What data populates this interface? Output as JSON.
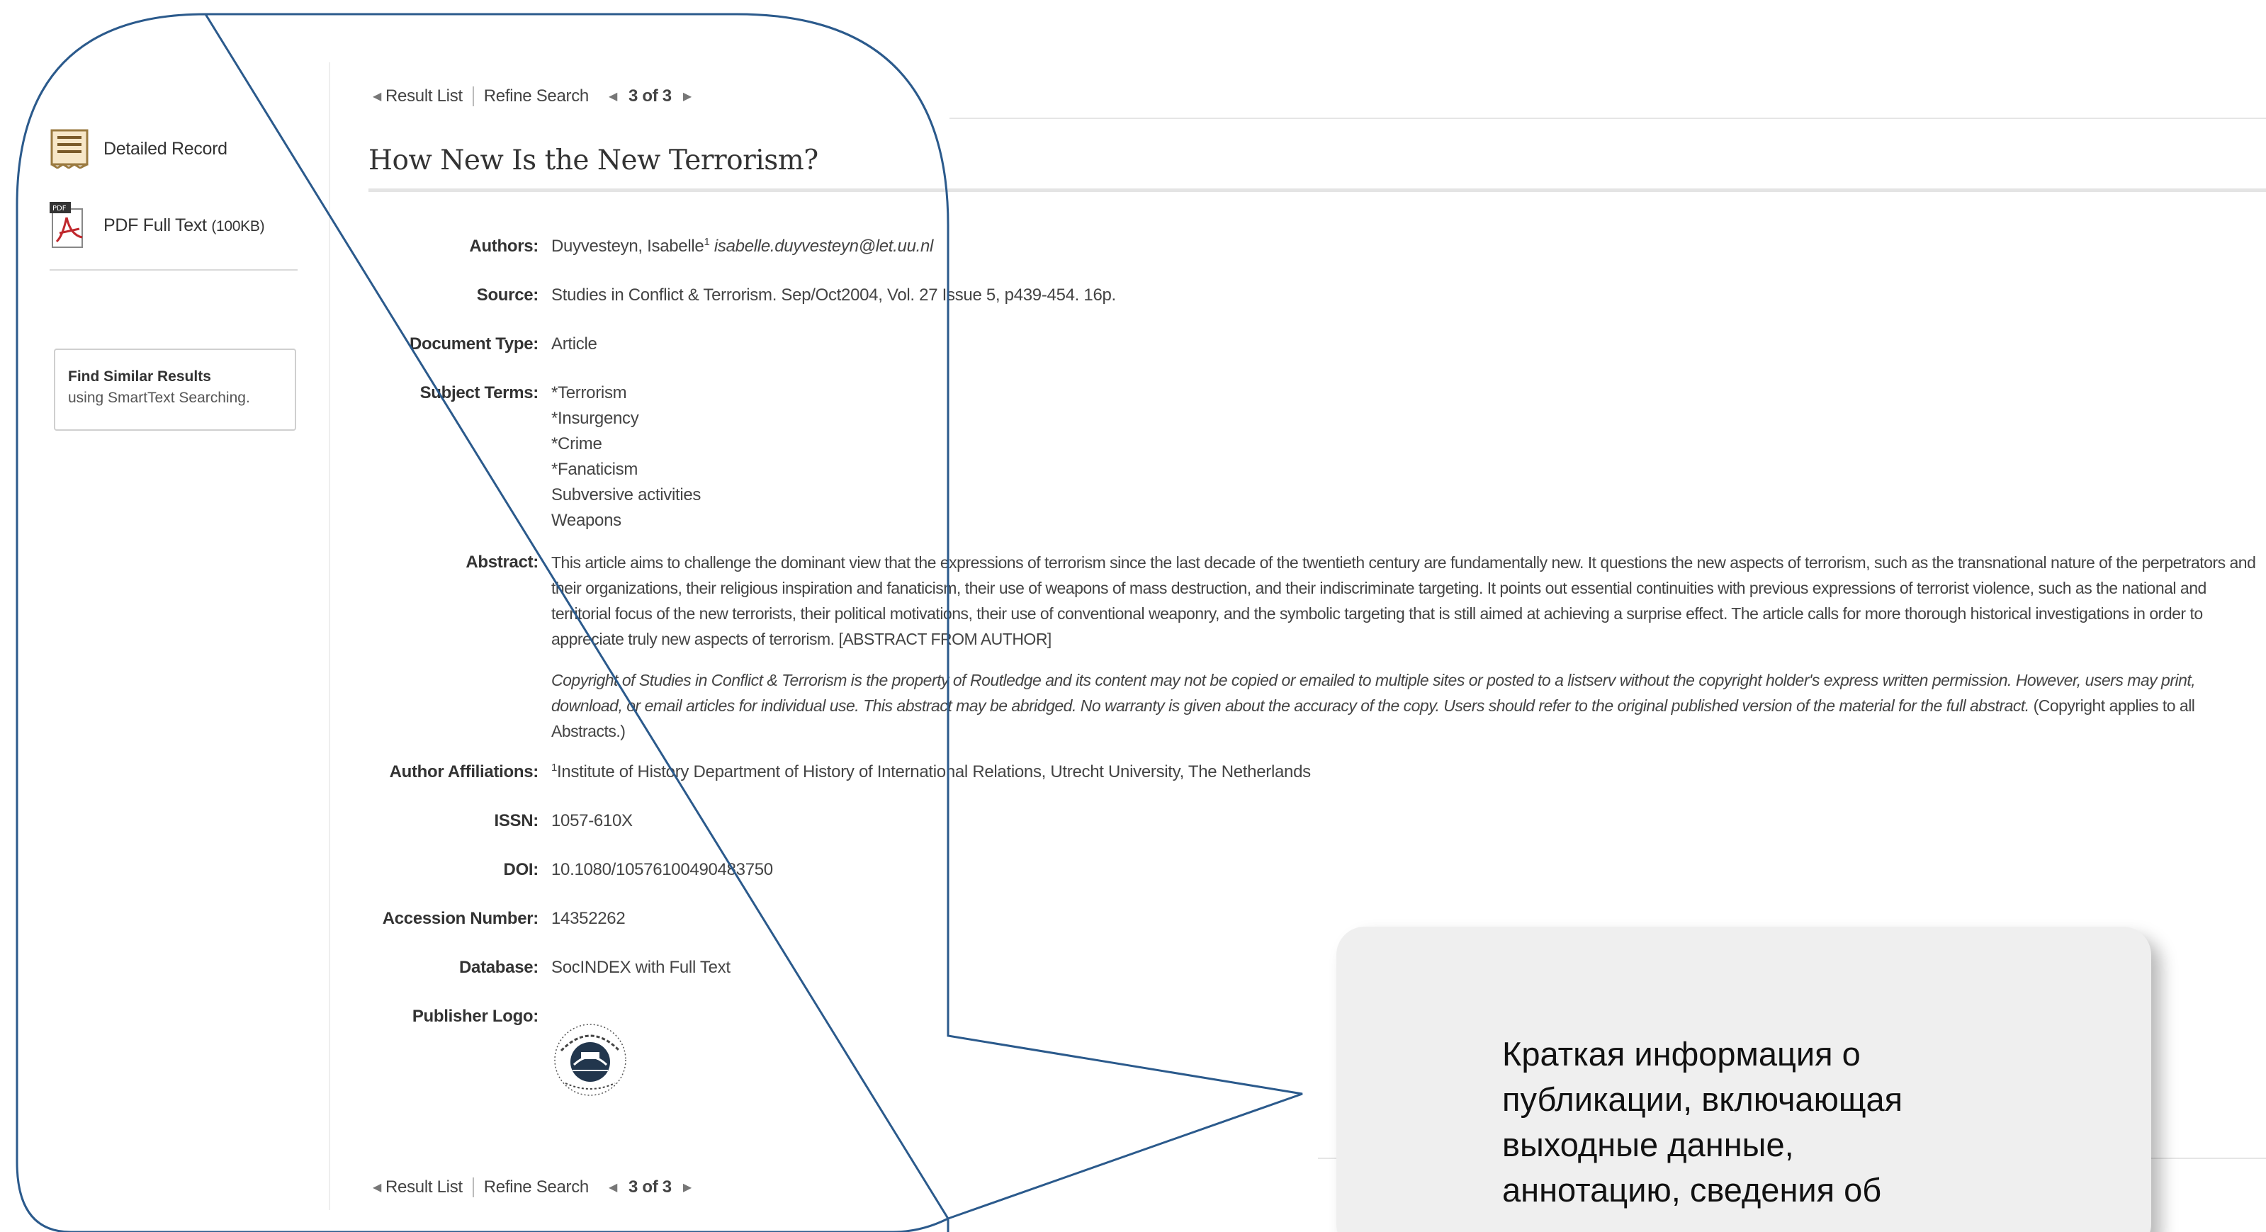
{
  "sidebar": {
    "detailed_record": "Detailed Record",
    "pdf_label": "PDF Full Text",
    "pdf_size": "(100KB)",
    "similar_title": "Find Similar Results",
    "similar_sub": "using SmartText Searching."
  },
  "nav": {
    "result_list": "Result List",
    "refine_search": "Refine Search",
    "count": "3 of 3"
  },
  "record": {
    "title": "How New Is the New Terrorism?",
    "authors_label": "Authors:",
    "author_name": "Duyvesteyn, Isabelle",
    "author_sup": "1",
    "author_email": "isabelle.duyvesteyn@let.uu.nl",
    "source_label": "Source:",
    "source": "Studies in Conflict & Terrorism. Sep/Oct2004, Vol. 27 Issue 5, p439-454. 16p.",
    "doctype_label": "Document Type:",
    "doctype": "Article",
    "subjects_label": "Subject Terms:",
    "subjects": [
      "*Terrorism",
      "*Insurgency",
      "*Crime",
      "*Fanaticism",
      "Subversive activities",
      "Weapons"
    ],
    "abstract_label": "Abstract:",
    "abstract": "This article aims to challenge the dominant view that the expressions of terrorism since the last decade of the twentieth century are fundamentally new. It questions the new aspects of terrorism, such as the transnational nature of the perpetrators and their organizations, their religious inspiration and fanaticism, their use of weapons of mass destruction, and their indiscriminate targeting. It points out essential continuities with previous expressions of terrorist violence, such as the national and territorial focus of the new terrorists, their political motivations, their use of conventional weaponry, and the symbolic targeting that is still aimed at achieving a surprise effect. The article calls for more thorough historical investigations in order to appreciate truly new aspects of terrorism. [ABSTRACT FROM AUTHOR]",
    "copyright": "Copyright of Studies in Conflict & Terrorism is the property of Routledge and its content may not be copied or emailed to multiple sites or posted to a listserv without the copyright holder's express written permission. However, users may print, download, or email articles for individual use. This abstract may be abridged. No warranty is given about the accuracy of the copy. Users should refer to the original published version of the material for the full abstract.",
    "copyright_tail": "(Copyright applies to all Abstracts.)",
    "affil_label": "Author Affiliations:",
    "affil_sup": "1",
    "affil": "Institute of History Department of History of International Relations, Utrecht University, The Netherlands",
    "issn_label": "ISSN:",
    "issn": "1057-610X",
    "doi_label": "DOI:",
    "doi": "10.1080/10576100490483750",
    "accession_label": "Accession Number:",
    "accession": "14352262",
    "database_label": "Database:",
    "database": "SocINDEX with Full Text",
    "publisher_label": "Publisher Logo:"
  },
  "callout": {
    "text_lines": [
      "Краткая информация о",
      "публикации, включающая",
      "выходные данные,",
      "аннотацию, сведения об"
    ],
    "accent": "#2b5a8c"
  },
  "icons": [
    "detailed-record-icon",
    "pdf-icon",
    "taylor-francis-logo"
  ]
}
